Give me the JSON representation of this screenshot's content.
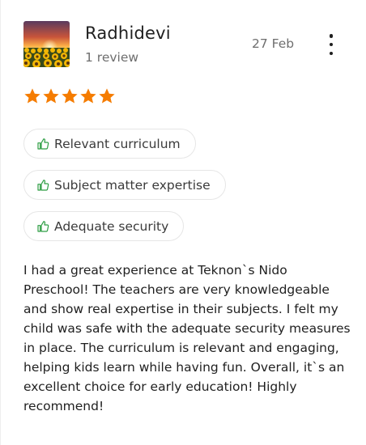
{
  "review": {
    "author": "Radhidevi",
    "review_count": "1 review",
    "date": "27 Feb",
    "rating": 5,
    "highlights": [
      {
        "label": "Relevant curriculum",
        "icon": "thumbs-up-icon"
      },
      {
        "label": "Subject matter expertise",
        "icon": "thumbs-up-icon"
      },
      {
        "label": "Adequate security",
        "icon": "thumbs-up-icon"
      }
    ],
    "text": "I had a great experience at Teknon`s Nido Preschool! The teachers are very knowledgeable and show real expertise in their subjects. I felt my child was safe with the adequate security measures in place. The curriculum is relevant and engaging, helping kids learn while having fun. Overall, it`s an excellent choice for early education! Highly recommend!"
  },
  "colors": {
    "star": "#f57c00",
    "thumb_icon": "#2e9e44",
    "chip_border": "#e6e6e6",
    "muted_text": "#6e6e6e"
  }
}
